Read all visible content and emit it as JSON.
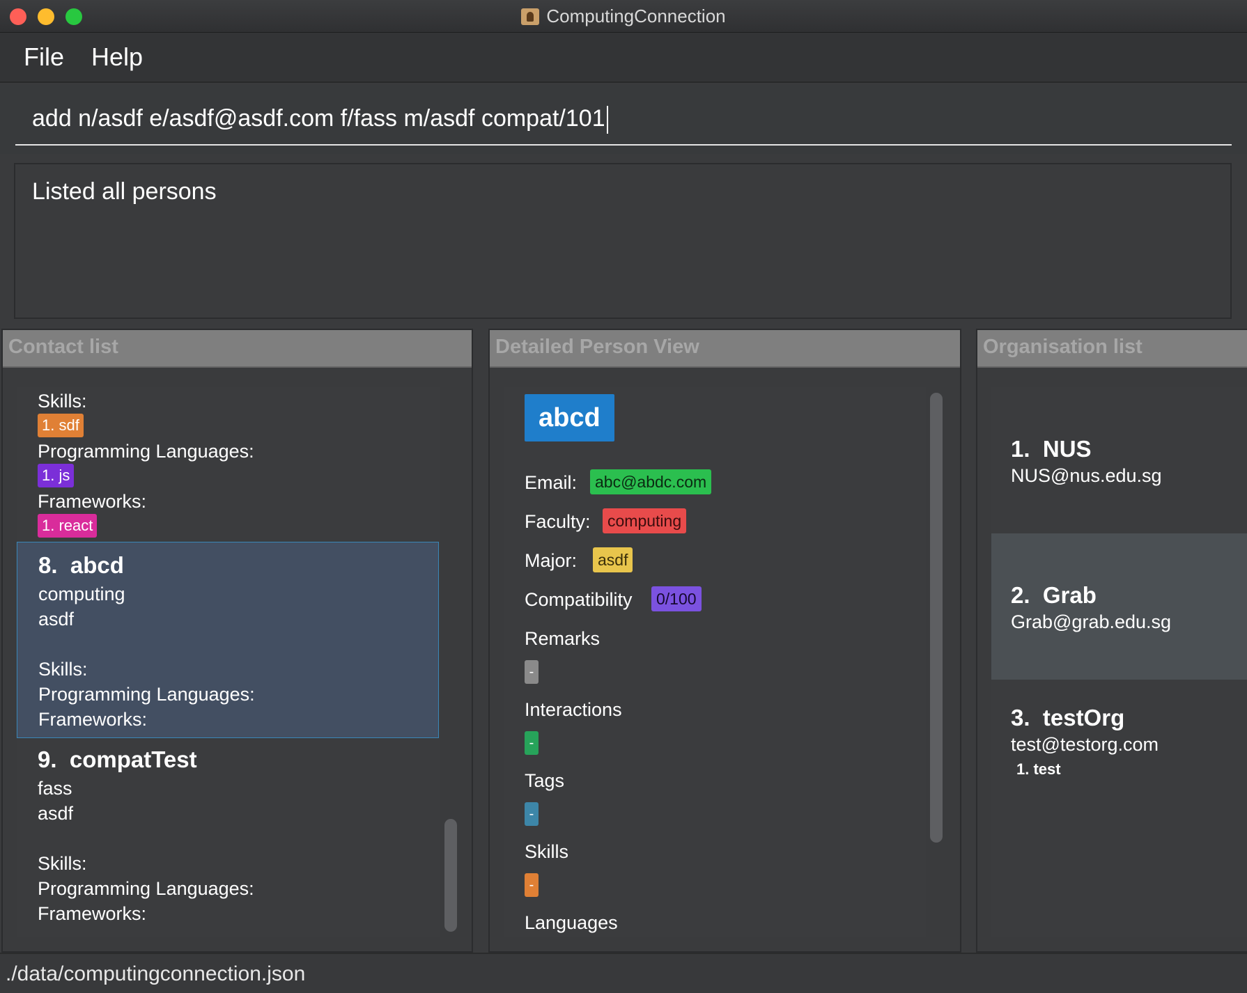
{
  "window": {
    "title": "ComputingConnection"
  },
  "menu": {
    "file": "File",
    "help": "Help"
  },
  "command": {
    "value": "add n/asdf e/asdf@asdf.com f/fass m/asdf compat/101"
  },
  "result": {
    "message": "Listed all persons"
  },
  "contact_list": {
    "header": "Contact list",
    "partial_card": {
      "skills_label": "Skills:",
      "skill_chip": "1. sdf",
      "languages_label": "Programming Languages:",
      "language_chip": "1. js",
      "frameworks_label": "Frameworks:",
      "framework_chip": "1. react"
    },
    "cards": [
      {
        "index": "8.",
        "name": "abcd",
        "faculty": "computing",
        "major": "asdf",
        "skills_label": "Skills:",
        "languages_label": "Programming Languages:",
        "frameworks_label": "Frameworks:"
      },
      {
        "index": "9.",
        "name": "compatTest",
        "faculty": "fass",
        "major": "asdf",
        "skills_label": "Skills:",
        "languages_label": "Programming Languages:",
        "frameworks_label": "Frameworks:"
      }
    ]
  },
  "detail": {
    "header": "Detailed Person View",
    "name": "abcd",
    "email_label": "Email:",
    "email": "abc@abdc.com",
    "faculty_label": "Faculty:",
    "faculty": "computing",
    "major_label": "Major:",
    "major": "asdf",
    "compat_label": "Compatibility",
    "compat": "0/100",
    "remarks_label": "Remarks",
    "remarks": "-",
    "interactions_label": "Interactions",
    "interactions": "-",
    "tags_label": "Tags",
    "tags": "-",
    "skills_label": "Skills",
    "skills": "-",
    "languages_label": "Languages"
  },
  "org_list": {
    "header": "Organisation list",
    "orgs": [
      {
        "index": "1.",
        "name": "NUS",
        "email": "NUS@nus.edu.sg",
        "tag": ""
      },
      {
        "index": "2.",
        "name": "Grab",
        "email": "Grab@grab.edu.sg",
        "tag": ""
      },
      {
        "index": "3.",
        "name": "testOrg",
        "email": "test@testorg.com",
        "tag": "1. test"
      }
    ]
  },
  "status": {
    "path": "./data/computingconnection.json"
  },
  "colors": {
    "skill": "#e08035",
    "language": "#7b2fd8",
    "framework": "#d92c9b",
    "email_chip": "#2bbf4f",
    "faculty_chip": "#e84b4b",
    "major_chip": "#e8c54c",
    "compat_chip": "#7b52e0",
    "name_chip": "#1f7ecb",
    "selected_card": "#434f62"
  }
}
